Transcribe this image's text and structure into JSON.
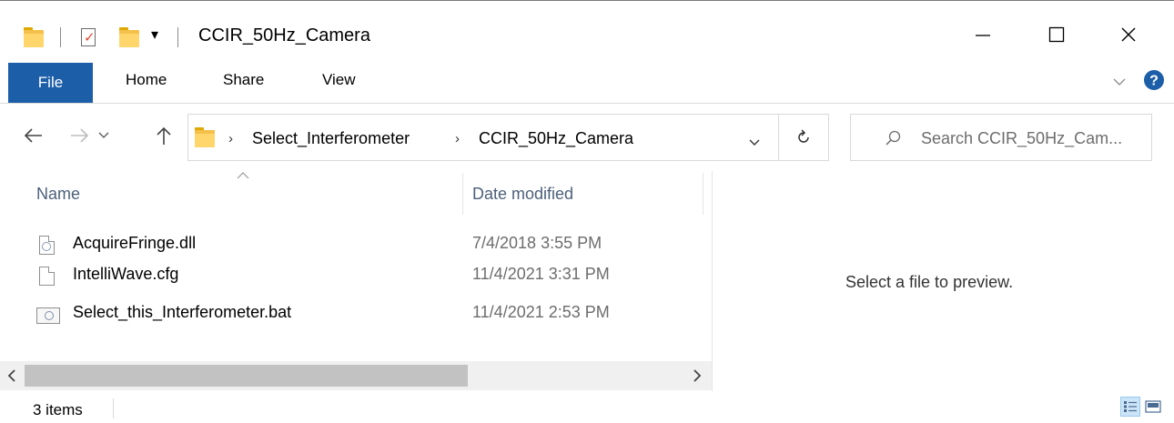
{
  "window": {
    "title": "CCIR_50Hz_Camera",
    "qat_dropdown_glyph": "▾"
  },
  "ribbon": {
    "tabs": [
      "File",
      "Home",
      "Share",
      "View"
    ]
  },
  "navigation": {
    "breadcrumbs": [
      "Select_Interferometer",
      "CCIR_50Hz_Camera"
    ],
    "breadcrumb_separator": "›",
    "search_placeholder": "Search CCIR_50Hz_Cam..."
  },
  "columns": {
    "name": "Name",
    "date_modified": "Date modified"
  },
  "files": [
    {
      "name": "AcquireFringe.dll",
      "date": "7/4/2018 3:55 PM",
      "icon": "dll-file-icon"
    },
    {
      "name": "IntelliWave.cfg",
      "date": "11/4/2021 3:31 PM",
      "icon": "blank-file-icon"
    },
    {
      "name": "Select_this_Interferometer.bat",
      "date": "11/4/2021 2:53 PM",
      "icon": "batch-file-icon"
    }
  ],
  "preview": {
    "message": "Select a file to preview."
  },
  "status": {
    "item_count": "3 items"
  },
  "colors": {
    "file_tab": "#1c5ea8",
    "help": "#1c5ea8",
    "folder": "#f5c04a",
    "column_header": "#4c607a",
    "selected_view": "#cce4f7"
  }
}
